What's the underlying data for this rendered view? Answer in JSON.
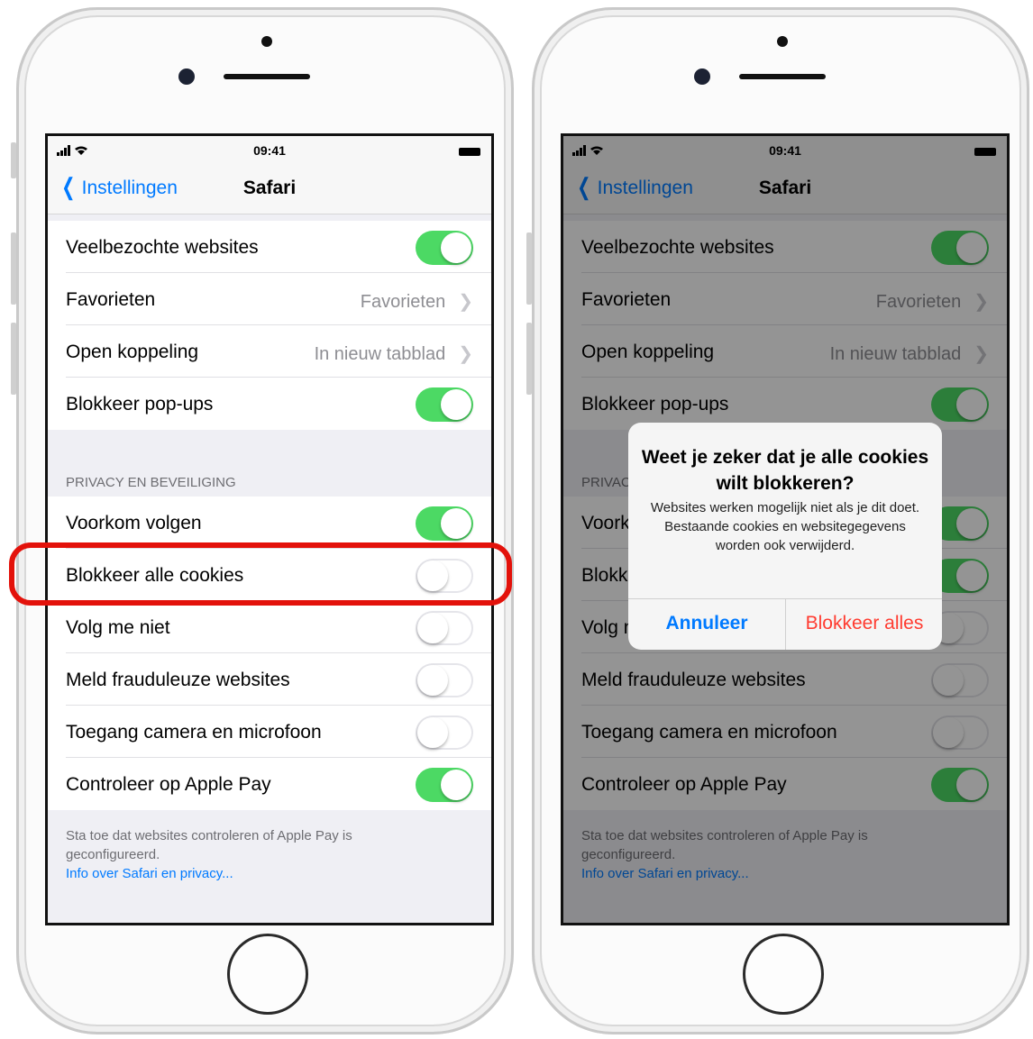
{
  "left_phone": {
    "status": {
      "time": "09:41"
    },
    "nav": {
      "back_label": "Instellingen",
      "title": "Safari"
    },
    "rows": [
      {
        "label": "Veelbezochte websites",
        "toggle": "on"
      },
      {
        "label": "Favorieten",
        "value": "Favorieten"
      },
      {
        "label": "Open koppeling",
        "value": "In nieuw tabblad"
      },
      {
        "label": "Blokkeer pop-ups",
        "toggle": "on"
      }
    ],
    "section_header": "PRIVACY EN BEVEILIGING",
    "privacy_rows": [
      {
        "label": "Voorkom volgen",
        "toggle": "on"
      },
      {
        "label": "Blokkeer alle cookies",
        "toggle": "off"
      },
      {
        "label": "Volg me niet",
        "toggle": "off"
      },
      {
        "label": "Meld frauduleuze websites",
        "toggle": "off"
      },
      {
        "label": "Toegang camera en microfoon",
        "toggle": "off"
      },
      {
        "label": "Controleer op Apple Pay",
        "toggle": "on"
      }
    ],
    "footer_text": "Sta toe dat websites controleren of Apple Pay is geconfigureerd.",
    "footer_link": "Info over Safari en privacy..."
  },
  "right_phone": {
    "status": {
      "time": "09:41"
    },
    "nav": {
      "back_label": "Instellingen",
      "title": "Safari"
    },
    "rows": [
      {
        "label": "Veelbezochte websites",
        "toggle": "on"
      },
      {
        "label": "Favorieten",
        "value": "Favorieten"
      },
      {
        "label": "Open koppeling",
        "value": "In nieuw tabblad"
      },
      {
        "label": "Blokkeer pop-ups",
        "toggle": "on"
      }
    ],
    "section_header": "PRIVACY EN BEVEILIGING",
    "privacy_rows": [
      {
        "label": "Voorkom volgen",
        "toggle": "on"
      },
      {
        "label": "Blokkeer alle cookies",
        "toggle": "on"
      },
      {
        "label": "Volg me niet",
        "toggle": "off"
      },
      {
        "label": "Meld frauduleuze websites",
        "toggle": "off"
      },
      {
        "label": "Toegang camera en microfoon",
        "toggle": "off"
      },
      {
        "label": "Controleer op Apple Pay",
        "toggle": "on"
      }
    ],
    "footer_text": "Sta toe dat websites controleren of Apple Pay is geconfigureerd.",
    "footer_link": "Info over Safari en privacy...",
    "alert": {
      "title": "Weet je zeker dat je alle cookies wilt blokkeren?",
      "message": "Websites werken mogelijk niet als je dit doet. Bestaande cookies en websitegegevens worden ook verwijderd.",
      "cancel_label": "Annuleer",
      "confirm_label": "Blokkeer alles"
    }
  },
  "colors": {
    "accent": "#007aff",
    "toggle_on": "#4cd964",
    "destructive": "#ff3b30",
    "highlight": "#e3120b"
  }
}
